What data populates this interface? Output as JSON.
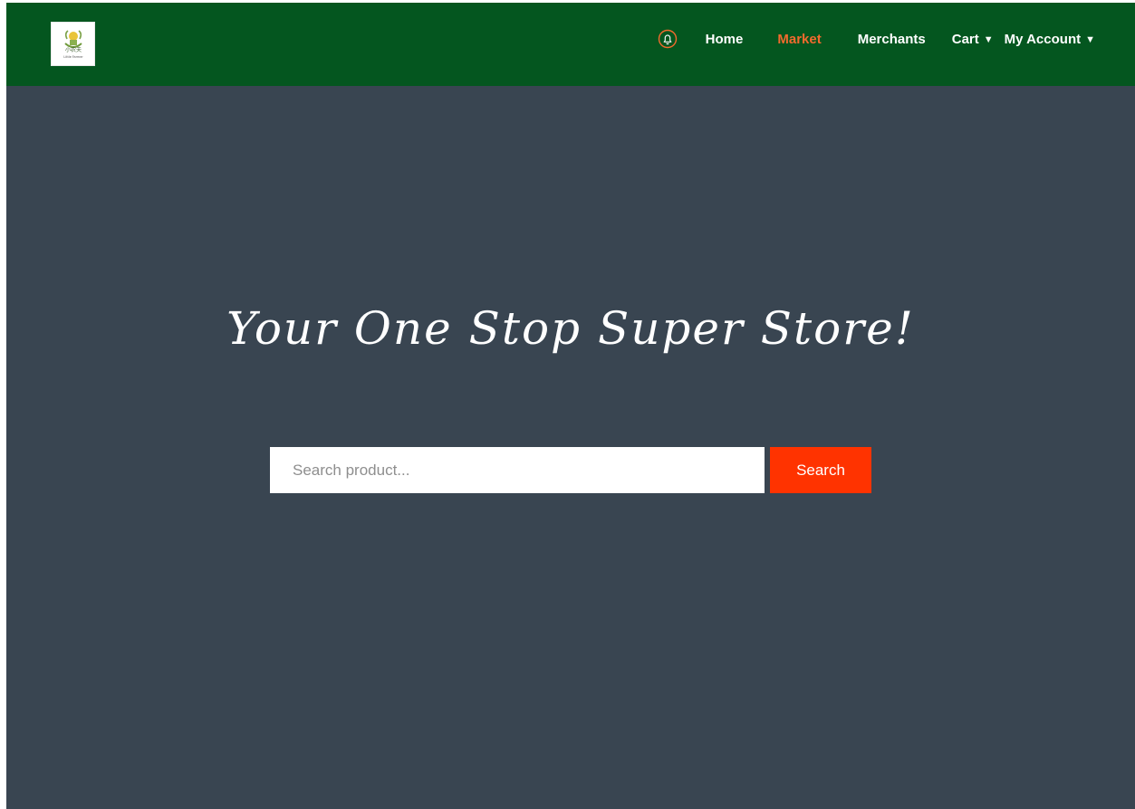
{
  "brand": {
    "logo_icon": "little-farmer-logo-icon",
    "logo_caption": "Little Farmer"
  },
  "nav": {
    "notification_icon": "bell-icon",
    "items": [
      {
        "label": "Home",
        "active": false
      },
      {
        "label": "Market",
        "active": true
      },
      {
        "label": "Merchants",
        "active": false
      },
      {
        "label": "Cart",
        "active": false,
        "caret": "▼"
      },
      {
        "label": "My Account",
        "active": false,
        "caret": "▼"
      }
    ]
  },
  "hero": {
    "title": "Your One Stop Super Store!"
  },
  "search": {
    "placeholder": "Search product...",
    "value": "",
    "button_label": "Search"
  },
  "colors": {
    "navbar": "#04561f",
    "background": "#394551",
    "active_link": "#f26a2e",
    "search_button": "#ff3300"
  }
}
